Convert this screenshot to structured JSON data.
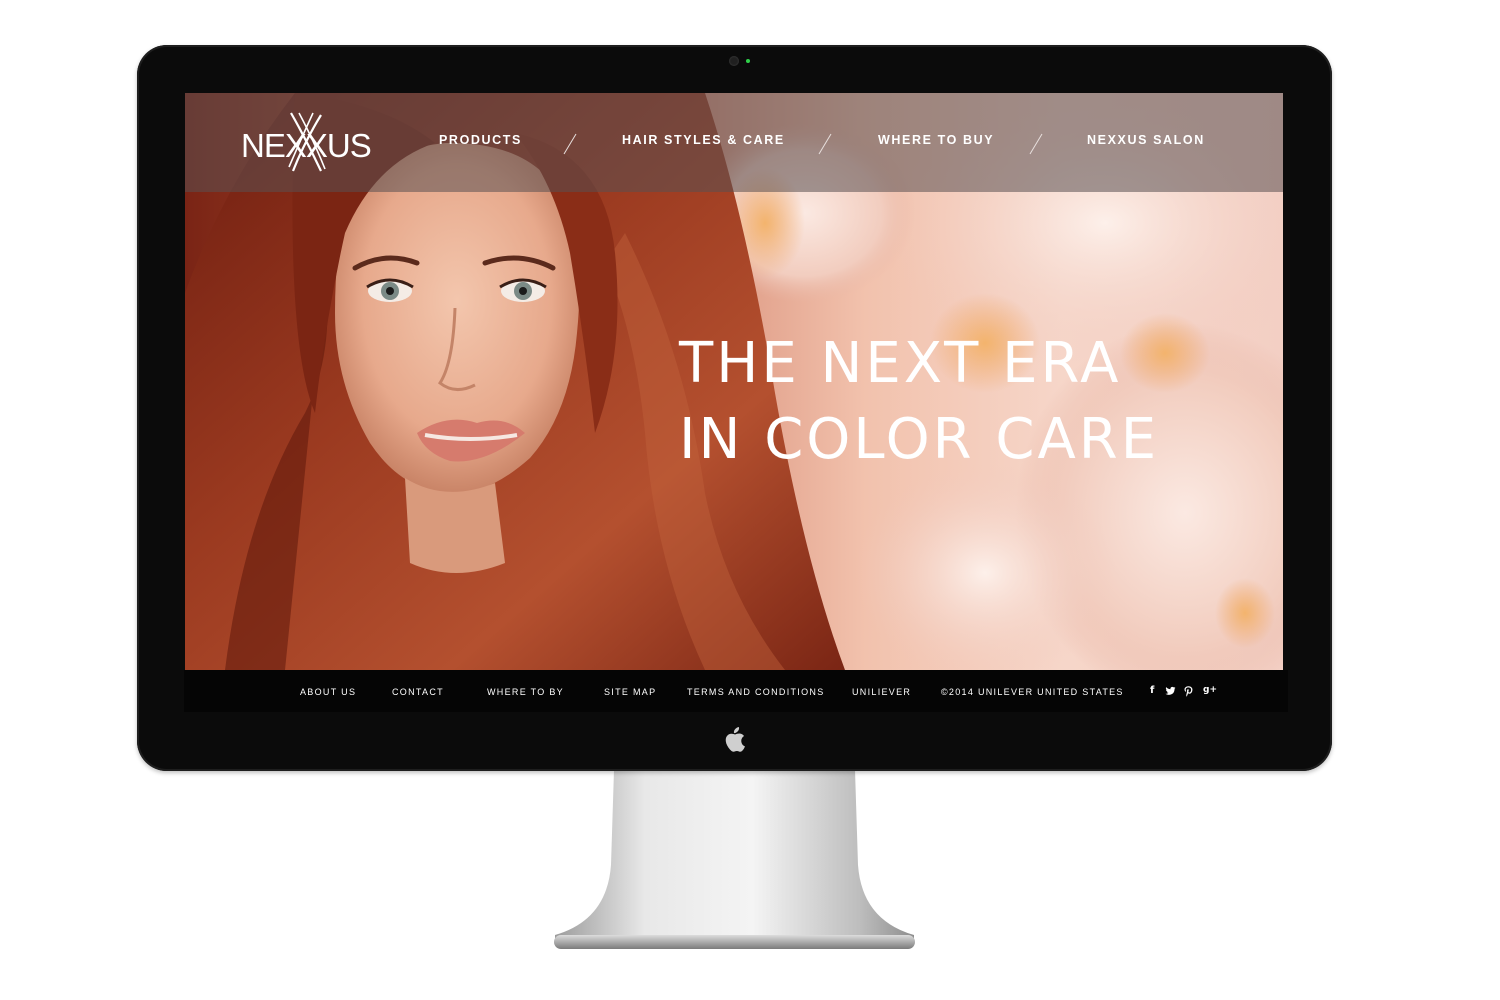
{
  "nav": {
    "logo_text": "NEXXUS",
    "items": [
      {
        "label": "PRODUCTS"
      },
      {
        "label": "HAIR STYLES & CARE"
      },
      {
        "label": "WHERE TO BUY"
      },
      {
        "label": "NEXXUS SALON"
      }
    ]
  },
  "hero": {
    "headline_line1": "THE NEXT ERA",
    "headline_line2": "IN COLOR CARE"
  },
  "footer": {
    "links": [
      {
        "label": "ABOUT US"
      },
      {
        "label": "CONTACT"
      },
      {
        "label": "WHERE TO BY"
      },
      {
        "label": "SITE MAP"
      },
      {
        "label": "TERMS AND CONDITIONS"
      },
      {
        "label": "UNILIEVER"
      }
    ],
    "copyright": "©2014 UNILEVER UNITED STATES",
    "social": [
      {
        "icon": "facebook-icon",
        "glyph": "f"
      },
      {
        "icon": "twitter-icon",
        "glyph": "t"
      },
      {
        "icon": "pinterest-icon",
        "glyph": "p"
      },
      {
        "icon": "google-plus-icon",
        "glyph": "g+"
      }
    ]
  },
  "colors": {
    "bezel": "#0b0b0b",
    "nav_overlay": "#5a5052",
    "footer": "#050505",
    "hair": "#8a2a18",
    "blossom": "#f4d3c8",
    "text": "#ffffff"
  }
}
